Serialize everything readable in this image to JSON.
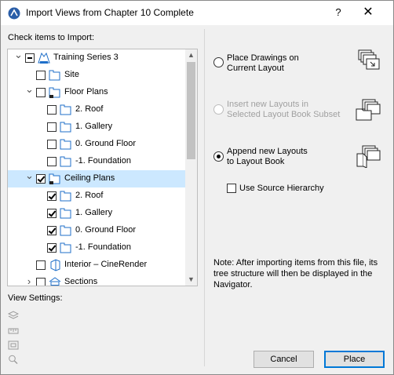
{
  "window": {
    "title": "Import Views from Chapter 10 Complete",
    "help_label": "?",
    "close_label": "✕"
  },
  "left": {
    "check_label": "Check items to Import:",
    "view_settings_label": "View Settings:"
  },
  "tree": {
    "items": [
      {
        "label": "Training Series 3",
        "state": "mixed",
        "expander": "expanded",
        "icon": "project-map-icon"
      },
      {
        "label": "Site",
        "state": "unchecked",
        "expander": "",
        "icon": "folder-view-icon"
      },
      {
        "label": "Floor Plans",
        "state": "unchecked",
        "expander": "expanded",
        "icon": "floor-plan-icon"
      },
      {
        "label": "2. Roof",
        "state": "unchecked",
        "expander": "",
        "icon": "folder-view-icon"
      },
      {
        "label": "1. Gallery",
        "state": "unchecked",
        "expander": "",
        "icon": "folder-view-icon"
      },
      {
        "label": "0. Ground Floor",
        "state": "unchecked",
        "expander": "",
        "icon": "folder-view-icon"
      },
      {
        "label": "-1. Foundation",
        "state": "unchecked",
        "expander": "",
        "icon": "folder-view-icon"
      },
      {
        "label": "Ceiling Plans",
        "state": "checked",
        "expander": "expanded",
        "icon": "ceiling-plan-icon",
        "selected": true
      },
      {
        "label": "2. Roof",
        "state": "checked",
        "expander": "",
        "icon": "folder-view-icon"
      },
      {
        "label": "1. Gallery",
        "state": "checked",
        "expander": "",
        "icon": "folder-view-icon"
      },
      {
        "label": "0. Ground Floor",
        "state": "checked",
        "expander": "",
        "icon": "folder-view-icon"
      },
      {
        "label": "-1. Foundation",
        "state": "checked",
        "expander": "",
        "icon": "folder-view-icon"
      },
      {
        "label": "Interior – CineRender",
        "state": "unchecked",
        "expander": "",
        "icon": "3d-view-icon"
      },
      {
        "label": "Sections",
        "state": "unchecked",
        "expander": "collapsed",
        "icon": "section-icon"
      }
    ]
  },
  "options": {
    "place_drawings": {
      "label": "Place Drawings on\nCurrent Layout",
      "selected": false,
      "disabled": false
    },
    "insert_layouts": {
      "label": "Insert new Layouts in\nSelected Layout Book Subset",
      "selected": false,
      "disabled": true
    },
    "append_layouts": {
      "label": "Append new Layouts\nto Layout Book",
      "selected": true,
      "disabled": false
    },
    "use_source_hierarchy": {
      "label": "Use Source Hierarchy",
      "checked": false
    }
  },
  "note": "Note: After importing items from this file, its tree structure will then be displayed in the Navigator.",
  "buttons": {
    "cancel": "Cancel",
    "place": "Place"
  },
  "colors": {
    "selection": "#cce8ff",
    "icon_blue": "#1f6fc9",
    "primary_border": "#0078d7"
  }
}
